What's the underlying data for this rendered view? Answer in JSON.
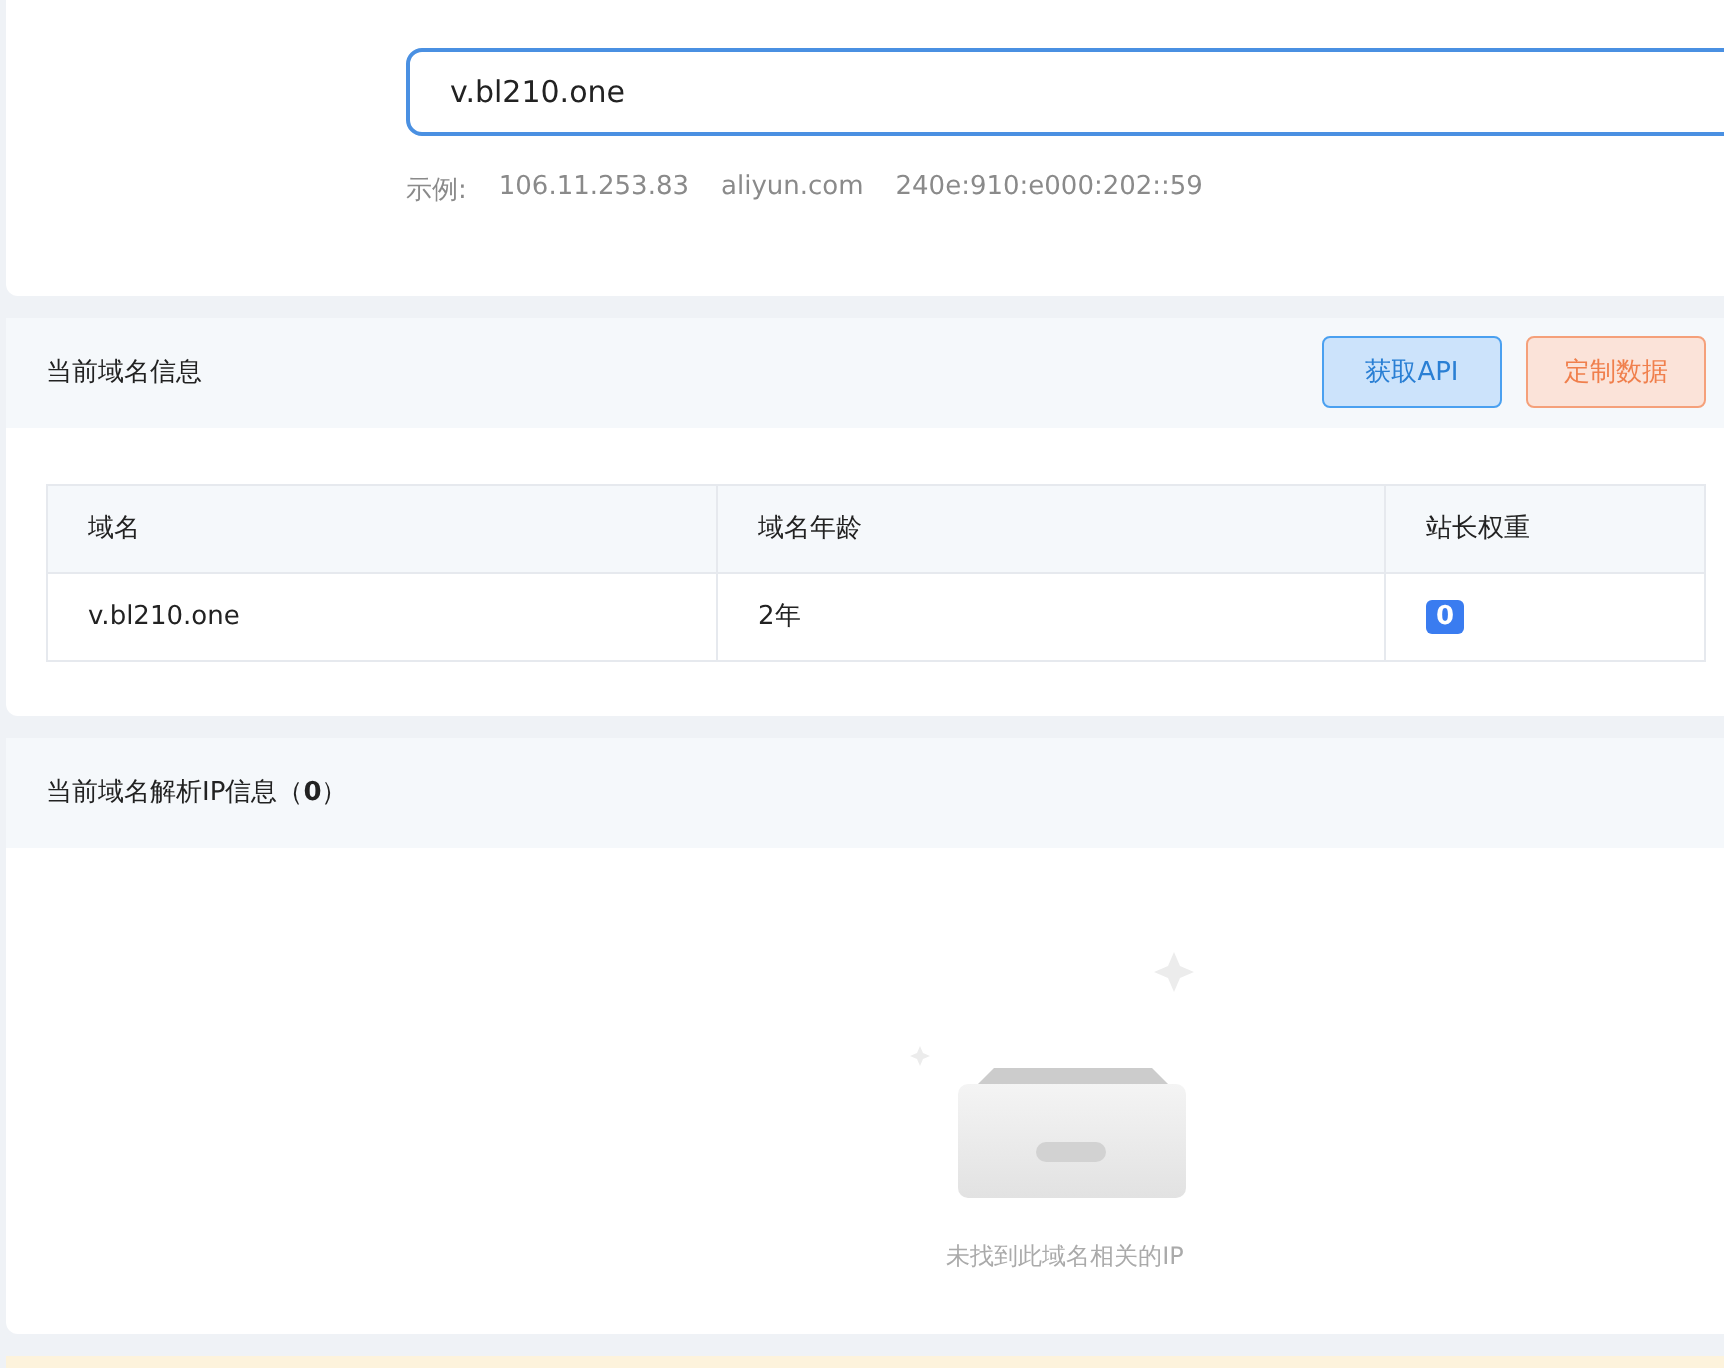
{
  "search": {
    "value": "v.bl210.one"
  },
  "examples": {
    "label": "示例:",
    "items": [
      "106.11.253.83",
      "aliyun.com",
      "240e:910:e000:202::59"
    ]
  },
  "domain_info": {
    "title": "当前域名信息",
    "buttons": [
      {
        "label": "获取API",
        "kind": "primary"
      },
      {
        "label": "定制数据",
        "kind": "warning"
      }
    ],
    "table": {
      "columns": [
        "域名",
        "域名年龄",
        "站长权重"
      ],
      "rows": [
        {
          "domain": "v.bl210.one",
          "age": "2年",
          "weight": "0"
        }
      ]
    }
  },
  "ip_info": {
    "title": "当前域名解析IP信息（**0**）",
    "empty_text": "未找到此域名相关的IP"
  }
}
